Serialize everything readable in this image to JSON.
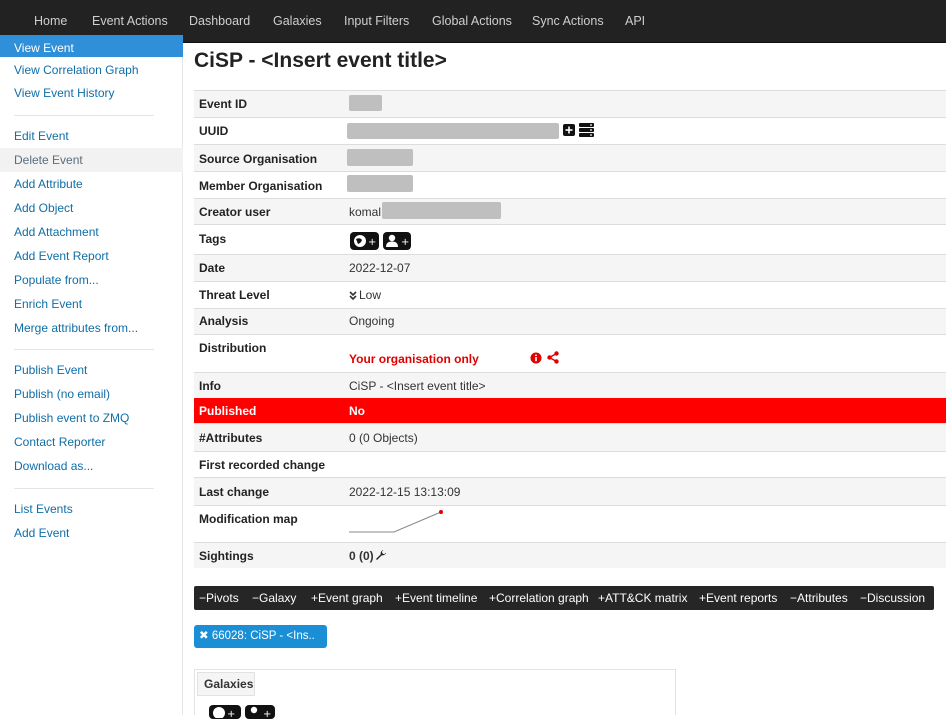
{
  "nav": {
    "items": [
      "Home",
      "Event Actions",
      "Dashboard",
      "Galaxies",
      "Input Filters",
      "Global Actions",
      "Sync Actions",
      "API"
    ]
  },
  "sidebar": {
    "items": [
      "View Event",
      "View Correlation Graph",
      "View Event History",
      "Edit Event",
      "Delete Event",
      "Add Attribute",
      "Add Object",
      "Add Attachment",
      "Add Event Report",
      "Populate from...",
      "Enrich Event",
      "Merge attributes from...",
      "Publish Event",
      "Publish (no email)",
      "Publish event to ZMQ",
      "Contact Reporter",
      "Download as...",
      "List Events",
      "Add Event"
    ]
  },
  "page": {
    "title": "CiSP - <Insert event title>"
  },
  "details": {
    "event_id_label": "Event ID",
    "uuid_label": "UUID",
    "source_org_label": "Source Organisation",
    "member_org_label": "Member Organisation",
    "creator_label": "Creator user",
    "creator_value": "komal",
    "tags_label": "Tags",
    "date_label": "Date",
    "date_value": "2022-12-07",
    "threat_label": "Threat Level",
    "threat_value": "Low",
    "analysis_label": "Analysis",
    "analysis_value": "Ongoing",
    "distribution_label": "Distribution",
    "distribution_value": "Your organisation only",
    "info_label": "Info",
    "info_value": "CiSP - <Insert event title>",
    "published_label": "Published",
    "published_value": "No",
    "attributes_label": "#Attributes",
    "attributes_value": "0 (0 Objects)",
    "first_change_label": "First recorded change",
    "last_change_label": "Last change",
    "last_change_value": "2022-12-15 13:13:09",
    "modmap_label": "Modification map",
    "sightings_label": "Sightings",
    "sightings_value": "0 (0)"
  },
  "tabs": {
    "items": [
      "Pivots",
      "Galaxy",
      "Event graph",
      "Event timeline",
      "Correlation graph",
      "ATT&CK matrix",
      "Event reports",
      "Attributes",
      "Discussion"
    ],
    "prefixes": [
      "−",
      "−",
      "+",
      "+",
      "+",
      "+",
      "+",
      "−",
      "−"
    ]
  },
  "chip": {
    "label": "66028: CiSP - <Ins..",
    "close": "✖"
  },
  "galaxies": {
    "label": "Galaxies"
  },
  "colors": {
    "accent": "#2f8fd8",
    "danger": "#ff0000",
    "nav_bg": "#222222",
    "link": "#0f6ea8"
  },
  "icons": [
    "plus-square-icon",
    "server-icon",
    "globe-plus-icon",
    "user-plus-icon",
    "double-chevron-down-icon",
    "info-circle-icon",
    "share-icon",
    "wrench-icon",
    "close-icon"
  ]
}
